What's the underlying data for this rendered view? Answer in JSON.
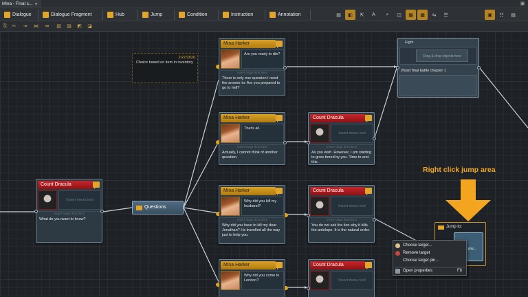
{
  "document_tab": {
    "title": "Mina - Final c...",
    "menu_arrow": "▸"
  },
  "toolbar": {
    "items": [
      {
        "key": "dialogue",
        "label": "Dialogue",
        "icon": "dialogue-icon",
        "color": "#e0a52a"
      },
      {
        "key": "dialogue_fragment",
        "label": "Dialogue Fragment",
        "icon": "dialogue-fragment-icon",
        "color": "#e0a52a"
      },
      {
        "key": "hub",
        "label": "Hub",
        "icon": "hub-icon",
        "color": "#e0a52a"
      },
      {
        "key": "jump",
        "label": "Jump",
        "icon": "jump-icon",
        "color": "#e0a52a"
      },
      {
        "key": "condition",
        "label": "Condition",
        "icon": "condition-icon",
        "color": "#e0a52a"
      },
      {
        "key": "instruction",
        "label": "Instruction",
        "icon": "instruction-icon",
        "color": "#e0a52a"
      },
      {
        "key": "annotation",
        "label": "Annotation",
        "icon": "annotation-icon",
        "color": "#e0a52a"
      }
    ]
  },
  "canvas": {
    "note": {
      "date": "2/27/2020",
      "text": "Choice based on item in inventory"
    },
    "hub": {
      "label": "Questions"
    },
    "fragment": {
      "title": "Fight",
      "slot_placeholder": "Drag & drop objects here",
      "text": "//Start final battle chapter 1"
    },
    "nodes": [
      {
        "speaker": "Count Dracula",
        "head": "red",
        "menu": "Insert menu text",
        "menu_empty": true,
        "stage": "Insert stage directions",
        "text": "What do you want to know?"
      },
      {
        "speaker": "Mina Harker",
        "head": "gold",
        "menu": "Are you ready to die?",
        "menu_empty": false,
        "stage": "Insert stage directions",
        "text": "There is only one question I need the answer to: Are you prepared to go to hell?"
      },
      {
        "speaker": "Mina Harker",
        "head": "gold",
        "menu": "That's all.",
        "menu_empty": false,
        "stage": "Insert stage directions",
        "text": "Actually, I cannot think of another question."
      },
      {
        "speaker": "Count Dracula",
        "head": "red",
        "menu": "Insert menu text",
        "menu_empty": true,
        "stage": "Insert stage directions",
        "text": "As you wish. However, I am starting to grow bored by you. Time to end this."
      },
      {
        "speaker": "Mina Harker",
        "head": "gold",
        "menu": "Why did you kill my husband?",
        "menu_empty": false,
        "stage": "Insert stage directions",
        "text": "Why did you have to kill my dear Jonathan? He travelled all the way just to help you."
      },
      {
        "speaker": "Count Dracula",
        "head": "red",
        "menu": "Insert menu text",
        "menu_empty": true,
        "stage": "Insert stage directions",
        "text": "You do not ask the lion why it kills the antelope. It is the natural order."
      },
      {
        "speaker": "Mina Harker",
        "head": "gold",
        "menu": "Why did you come to London?",
        "menu_empty": false,
        "stage": "",
        "text": ""
      },
      {
        "speaker": "Count Dracula",
        "head": "red",
        "menu": "Insert menu text",
        "menu_empty": true,
        "stage": "",
        "text": ""
      }
    ],
    "jump": {
      "title": "Jump to:",
      "target_text": "Ques... you... more?"
    },
    "annotation": {
      "text": "Right click jump area",
      "color": "#f3a51f"
    },
    "context_menu": {
      "items": [
        {
          "label": "Choose target...",
          "icon": "target-icon",
          "icon_color": "#d7c28a",
          "shortcut": ""
        },
        {
          "label": "Remove target",
          "icon": "remove-icon",
          "icon_color": "#c9463a",
          "shortcut": ""
        },
        {
          "label": "Choose target pin...",
          "icon": "",
          "icon_color": "",
          "shortcut": ""
        },
        {
          "label": "Open properties",
          "icon": "properties-icon",
          "icon_color": "#8a97a2",
          "shortcut": "F8"
        }
      ]
    }
  }
}
